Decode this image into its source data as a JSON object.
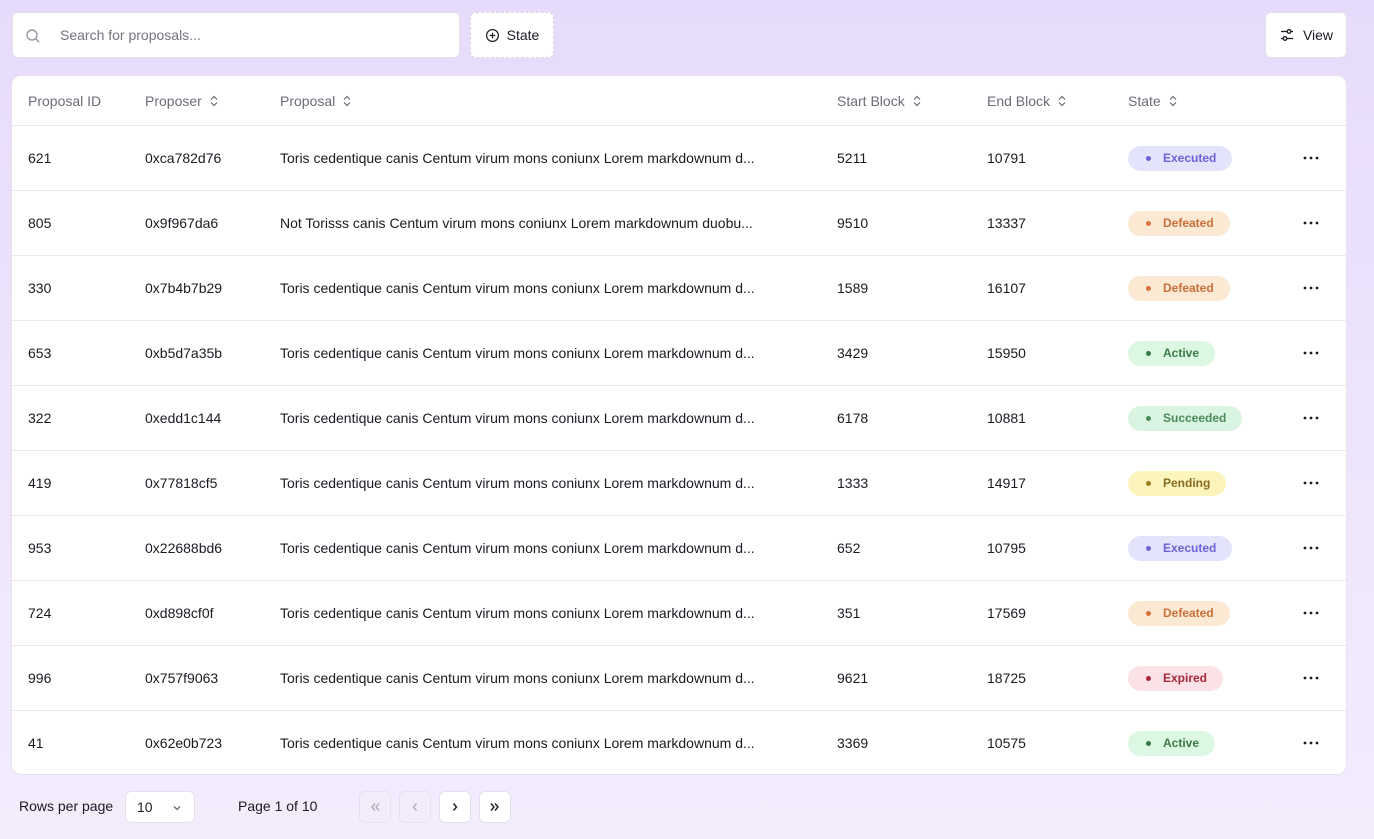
{
  "toolbar": {
    "search_placeholder": "Search for proposals...",
    "state_filter_label": "State",
    "view_label": "View"
  },
  "table": {
    "headers": {
      "id": "Proposal ID",
      "proposer": "Proposer",
      "proposal": "Proposal",
      "start": "Start Block",
      "end": "End Block",
      "state": "State"
    },
    "rows": [
      {
        "id": "621",
        "proposer": "0xca782d76",
        "proposal": "Toris cedentique canis Centum virum mons coniunx Lorem markdownum d...",
        "start": "5211",
        "end": "10791",
        "state": "Executed"
      },
      {
        "id": "805",
        "proposer": "0x9f967da6",
        "proposal": "Not Torisss canis Centum virum mons coniunx Lorem markdownum duobu...",
        "start": "9510",
        "end": "13337",
        "state": "Defeated"
      },
      {
        "id": "330",
        "proposer": "0x7b4b7b29",
        "proposal": "Toris cedentique canis Centum virum mons coniunx Lorem markdownum d...",
        "start": "1589",
        "end": "16107",
        "state": "Defeated"
      },
      {
        "id": "653",
        "proposer": "0xb5d7a35b",
        "proposal": "Toris cedentique canis Centum virum mons coniunx Lorem markdownum d...",
        "start": "3429",
        "end": "15950",
        "state": "Active"
      },
      {
        "id": "322",
        "proposer": "0xedd1c144",
        "proposal": "Toris cedentique canis Centum virum mons coniunx Lorem markdownum d...",
        "start": "6178",
        "end": "10881",
        "state": "Succeeded"
      },
      {
        "id": "419",
        "proposer": "0x77818cf5",
        "proposal": "Toris cedentique canis Centum virum mons coniunx Lorem markdownum d...",
        "start": "1333",
        "end": "14917",
        "state": "Pending"
      },
      {
        "id": "953",
        "proposer": "0x22688bd6",
        "proposal": "Toris cedentique canis Centum virum mons coniunx Lorem markdownum d...",
        "start": "652",
        "end": "10795",
        "state": "Executed"
      },
      {
        "id": "724",
        "proposer": "0xd898cf0f",
        "proposal": "Toris cedentique canis Centum virum mons coniunx Lorem markdownum d...",
        "start": "351",
        "end": "17569",
        "state": "Defeated"
      },
      {
        "id": "996",
        "proposer": "0x757f9063",
        "proposal": "Toris cedentique canis Centum virum mons coniunx Lorem markdownum d...",
        "start": "9621",
        "end": "18725",
        "state": "Expired"
      },
      {
        "id": "41",
        "proposer": "0x62e0b723",
        "proposal": "Toris cedentique canis Centum virum mons coniunx Lorem markdownum d...",
        "start": "3369",
        "end": "10575",
        "state": "Active"
      }
    ]
  },
  "state_colors": {
    "Executed": {
      "bg": "#e3e3fb",
      "fg": "#6c63d8",
      "dot": "#6c63d8"
    },
    "Defeated": {
      "bg": "#fbe9d4",
      "fg": "#c9703a",
      "dot": "#d9733a"
    },
    "Active": {
      "bg": "#ddf8e2",
      "fg": "#3a7a46",
      "dot": "#3a7a46"
    },
    "Succeeded": {
      "bg": "#d9f5e1",
      "fg": "#4a8a5a",
      "dot": "#4a8a5a"
    },
    "Pending": {
      "bg": "#fbf5bd",
      "fg": "#8a6a1e",
      "dot": "#a07a1e"
    },
    "Expired": {
      "bg": "#fbe2e6",
      "fg": "#a8283a",
      "dot": "#a8283a"
    }
  },
  "footer": {
    "rows_per_page_label": "Rows per page",
    "rows_per_page_value": "10",
    "page_info": "Page 1 of 10"
  },
  "icons": {
    "search": "search-icon",
    "state_filter": "plus-circle-icon",
    "view": "sliders-icon",
    "sort": "sort-icon",
    "row_menu": "more-horizontal-icon",
    "first": "chevrons-left-icon",
    "prev": "chevron-left-icon",
    "next": "chevron-right-icon",
    "last": "chevrons-right-icon"
  }
}
